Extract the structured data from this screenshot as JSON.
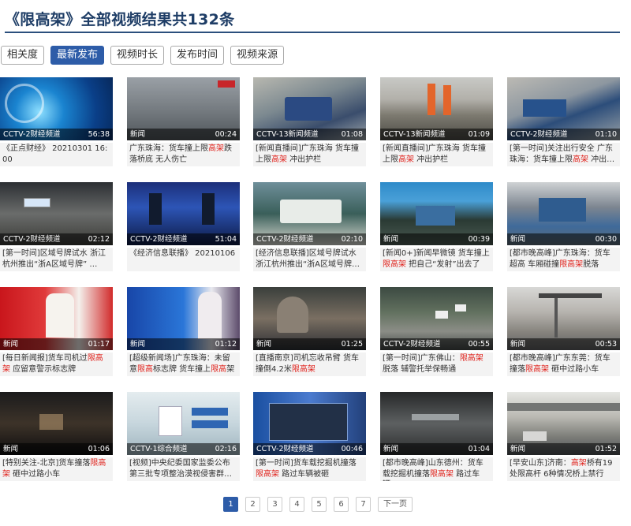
{
  "page": {
    "title": "《限高架》全部视频结果共132条"
  },
  "sort": {
    "buttons": [
      "相关度",
      "最新发布",
      "视频时长",
      "发布时间",
      "视频来源"
    ],
    "active_index": 1
  },
  "videos": [
    {
      "source": "CCTV-2财经频道",
      "duration": "56:38",
      "title": "《正点财经》 20210301 16:00",
      "highlight": ""
    },
    {
      "source": "新闻",
      "duration": "00:24",
      "title": "广东珠海：货车撞上限高架跌落桥底 无人伤亡",
      "highlight": "高架"
    },
    {
      "source": "CCTV-13新闻频道",
      "duration": "01:08",
      "title": "[新闻直播间]广东珠海 货车撞上限高架 冲出护栏",
      "highlight": "高架"
    },
    {
      "source": "CCTV-13新闻频道",
      "duration": "01:09",
      "title": "[新闻直播间]广东珠海 货车撞上限高架 冲出护栏",
      "highlight": "高架"
    },
    {
      "source": "CCTV-2财经频道",
      "duration": "01:10",
      "title": "[第一时间]关注出行安全 广东珠海：货车撞上限高架 冲出…",
      "highlight": "高架"
    },
    {
      "source": "CCTV-2财经频道",
      "duration": "02:12",
      "title": "[第一时间]区域号牌试水 浙江杭州推出“浙A区域号牌” …",
      "highlight": ""
    },
    {
      "source": "CCTV-2财经频道",
      "duration": "51:04",
      "title": "《经济信息联播》 20210106",
      "highlight": ""
    },
    {
      "source": "CCTV-2财经频道",
      "duration": "02:10",
      "title": "[经济信息联播]区域号牌试水 浙江杭州推出“浙A区域号牌…",
      "highlight": ""
    },
    {
      "source": "新闻",
      "duration": "00:39",
      "title": "[新闻0+]新闻早微镜 货车撞上限高架 把自己“发射”出去了",
      "highlight": "限高架"
    },
    {
      "source": "新闻",
      "duration": "00:30",
      "title": "[都市晚高峰]广东珠海：货车超高 车厢碰撞限高架脱落",
      "highlight": "限高架"
    },
    {
      "source": "新闻",
      "duration": "01:17",
      "title": "[每日新闻报]货车司机过限高架 应留意警示标志牌",
      "highlight": "限高架"
    },
    {
      "source": "新闻",
      "duration": "01:12",
      "title": "[超级新闻场]广东珠海：未留意限高标志牌 货车撞上限高架",
      "highlight": "限高"
    },
    {
      "source": "新闻",
      "duration": "01:25",
      "title": "[直播南京]司机忘收吊臂 货车撞倒4.2米限高架",
      "highlight": "限高架"
    },
    {
      "source": "CCTV-2财经频道",
      "duration": "00:55",
      "title": "[第一时间]广东佛山：限高架脱落 辅警托举保畅通",
      "highlight": "限高架"
    },
    {
      "source": "新闻",
      "duration": "00:53",
      "title": "[都市晚高峰]广东东莞：货车撞落限高架 砸中过路小车",
      "highlight": "限高架"
    },
    {
      "source": "新闻",
      "duration": "01:06",
      "title": "[特别关注-北京]货车撞落限高架 砸中过路小车",
      "highlight": "限高架"
    },
    {
      "source": "CCTV-1综合频道",
      "duration": "02:16",
      "title": "[视频]中央纪委国家监委公布第三批专项整治漠视侵害群…",
      "highlight": ""
    },
    {
      "source": "CCTV-2财经频道",
      "duration": "00:46",
      "title": "[第一时间]货车载挖掘机撞落限高架 路过车辆被砸",
      "highlight": "限高架"
    },
    {
      "source": "新闻",
      "duration": "01:04",
      "title": "[都市晚高峰]山东德州：货车载挖掘机撞落限高架 路过车辆…",
      "highlight": "限高架"
    },
    {
      "source": "新闻",
      "duration": "01:52",
      "title": "[早安山东]济南：高架桥有19处限高杆 6种情况桥上禁行",
      "highlight": "高架"
    }
  ],
  "pager": {
    "pages": [
      "1",
      "2",
      "3",
      "4",
      "5",
      "6",
      "7"
    ],
    "active_page": "1",
    "next_label": "下一页"
  },
  "colors": {
    "title": "#1e3d66",
    "accent": "#2d5ca8",
    "highlight": "#e0201a"
  }
}
